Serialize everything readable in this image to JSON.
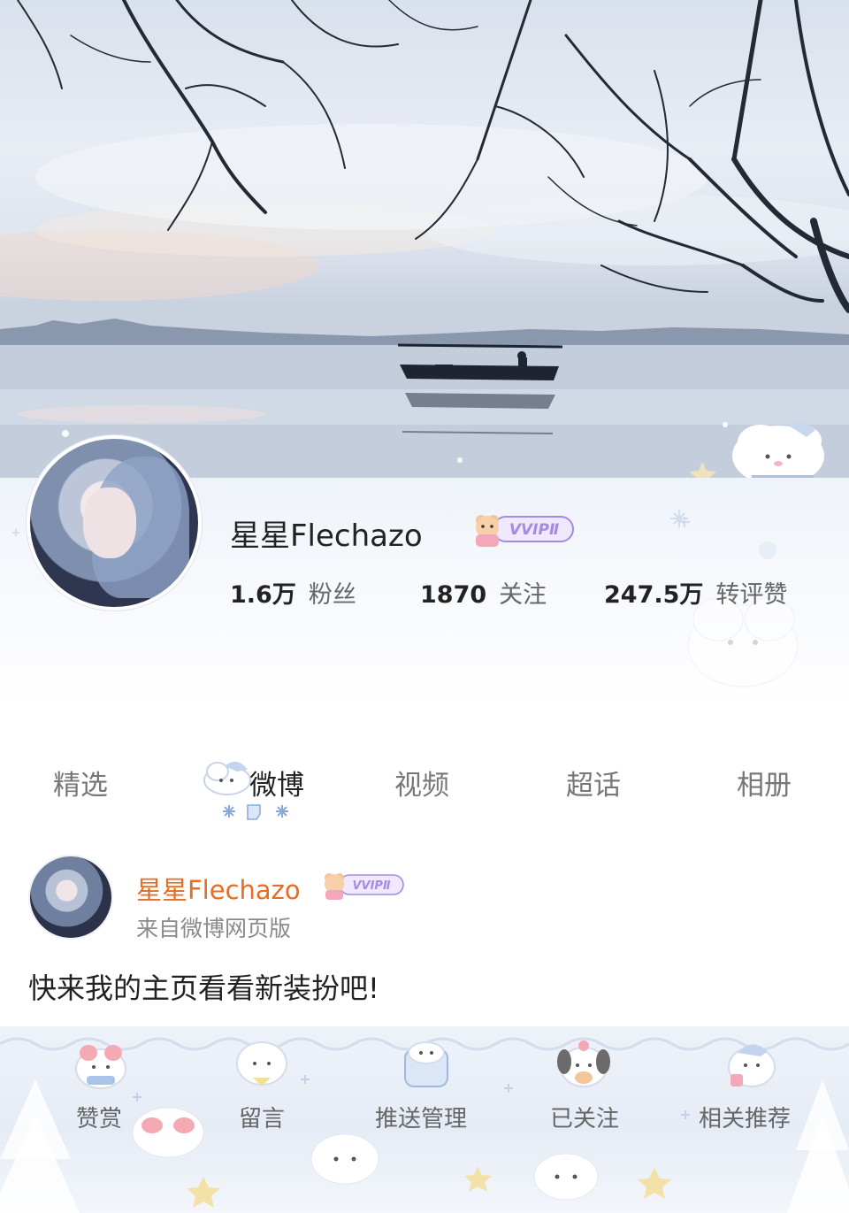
{
  "profile": {
    "name": "星星Flechazo",
    "badge": "VVIPⅡ",
    "stats": [
      {
        "value": "1.6万",
        "label": "粉丝"
      },
      {
        "value": "1870",
        "label": "关注"
      },
      {
        "value": "247.5万",
        "label": "转评赞"
      }
    ]
  },
  "tabs": [
    {
      "label": "精选"
    },
    {
      "label": "微博"
    },
    {
      "label": "视频"
    },
    {
      "label": "超话"
    },
    {
      "label": "相册"
    }
  ],
  "active_tab": "微博",
  "post": {
    "author": "星星Flechazo",
    "badge": "VVIPⅡ",
    "source": "来自微博网页版",
    "text": "快来我的主页看看新装扮吧!"
  },
  "bottom_bar": [
    {
      "label": "赞赏"
    },
    {
      "label": "留言"
    },
    {
      "label": "推送管理"
    },
    {
      "label": "已关注"
    },
    {
      "label": "相关推荐"
    }
  ],
  "colors": {
    "accent_name": "#e86d24",
    "badge_purple": "#a48be0",
    "text_primary": "#222222",
    "text_secondary": "#777777"
  },
  "icons": [
    "snowflake-icon",
    "cloud-mascot-icon",
    "vvip-badge-icon",
    "bear-mascot-icon"
  ]
}
